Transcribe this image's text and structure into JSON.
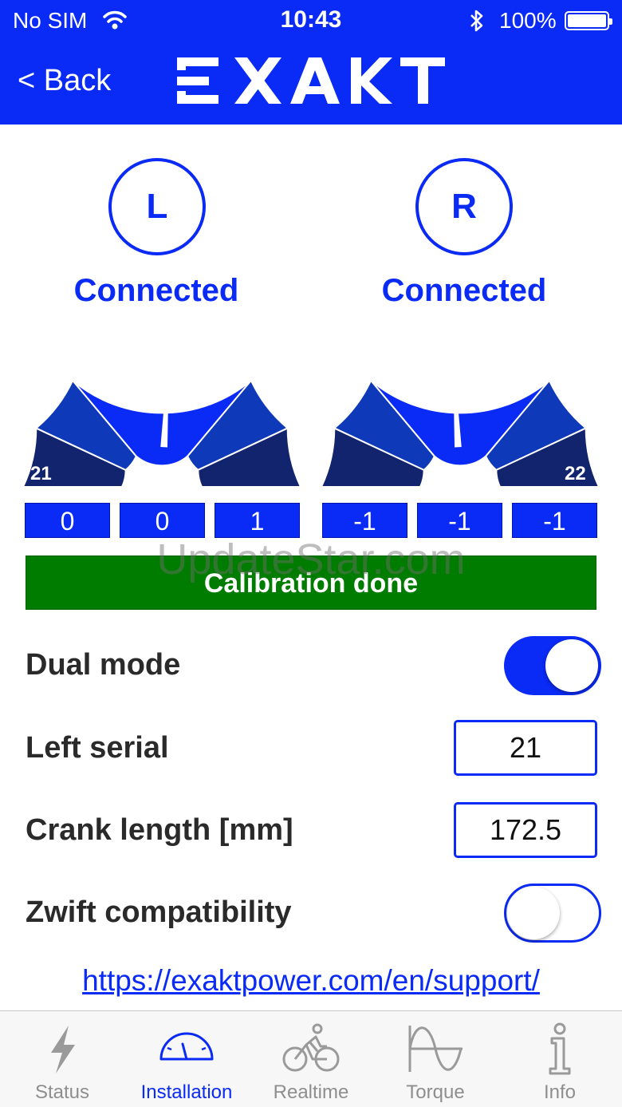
{
  "status_bar": {
    "carrier": "No SIM",
    "time": "10:43",
    "battery": "100%"
  },
  "nav": {
    "back_label": "< Back",
    "logo_text": "EXAKT"
  },
  "sensors": {
    "left": {
      "letter": "L",
      "status": "Connected",
      "gauge_value": "21",
      "values": [
        "0",
        "0",
        "1"
      ]
    },
    "right": {
      "letter": "R",
      "status": "Connected",
      "gauge_value": "22",
      "values": [
        "-1",
        "-1",
        "-1"
      ]
    }
  },
  "calibration": {
    "label": "Calibration done",
    "color": "#007c00"
  },
  "watermark": "UpdateStar.com",
  "settings": {
    "dual_mode": {
      "label": "Dual mode",
      "on": true
    },
    "left_serial": {
      "label": "Left serial",
      "value": "21"
    },
    "crank_length": {
      "label": "Crank length [mm]",
      "value": "172.5"
    },
    "zwift": {
      "label": "Zwift compatibility",
      "on": false
    }
  },
  "support_link": "https://exaktpower.com/en/support/",
  "tabs": [
    {
      "label": "Status",
      "icon": "lightning-icon",
      "active": false
    },
    {
      "label": "Installation",
      "icon": "gauge-icon",
      "active": true
    },
    {
      "label": "Realtime",
      "icon": "cyclist-icon",
      "active": false
    },
    {
      "label": "Torque",
      "icon": "wave-icon",
      "active": false
    },
    {
      "label": "Info",
      "icon": "info-icon",
      "active": false
    }
  ],
  "colors": {
    "brand_blue": "#0a2af5",
    "gauge_dark": "#13246e",
    "gauge_mid": "#0e39b8",
    "gauge_bright": "#0a2af5"
  }
}
